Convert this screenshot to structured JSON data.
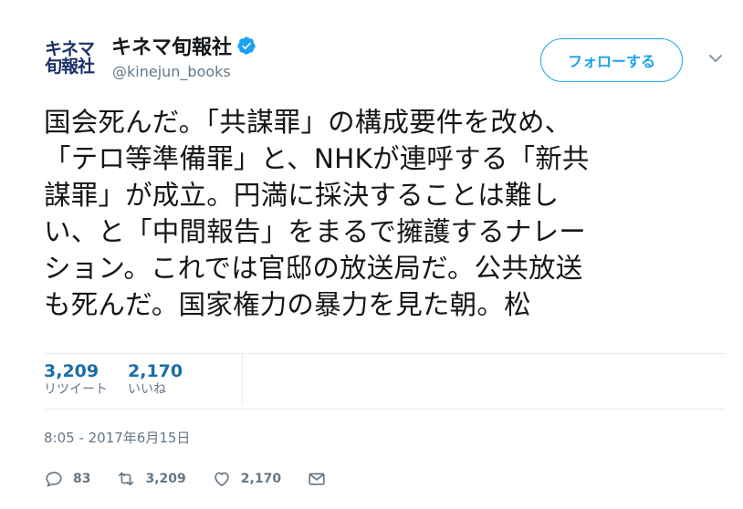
{
  "account": {
    "avatar_line1": "キネマ",
    "avatar_line2": "旬報社",
    "display_name": "キネマ旬報社",
    "handle": "@kinejun_books",
    "verified_icon": "verified-badge-icon"
  },
  "follow_button": {
    "label": "フォローする"
  },
  "tweet": {
    "lines": [
      "国会死んだ。「共謀罪」の構成要件を改め、",
      "「テロ等準備罪」と、NHKが連呼する「新共",
      "謀罪」が成立。円満に採決することは難し",
      "い、と「中間報告」をまるで擁護するナレー",
      "ション。これでは官邸の放送局だ。公共放送",
      "も死んだ。国家権力の暴力を見た朝。松"
    ]
  },
  "stats": {
    "retweets_value": "3,209",
    "retweets_label": "リツイート",
    "likes_value": "2,170",
    "likes_label": "いいね"
  },
  "timestamp": "8:05 - 2017年6月15日",
  "actions": {
    "reply_count": "83",
    "retweet_count": "3,209",
    "like_count": "2,170"
  },
  "colors": {
    "accent": "#1da1f2",
    "stat_value": "#1b6ca8",
    "muted": "#657786",
    "text": "#14171a",
    "avatar_text": "#1b2f66"
  }
}
